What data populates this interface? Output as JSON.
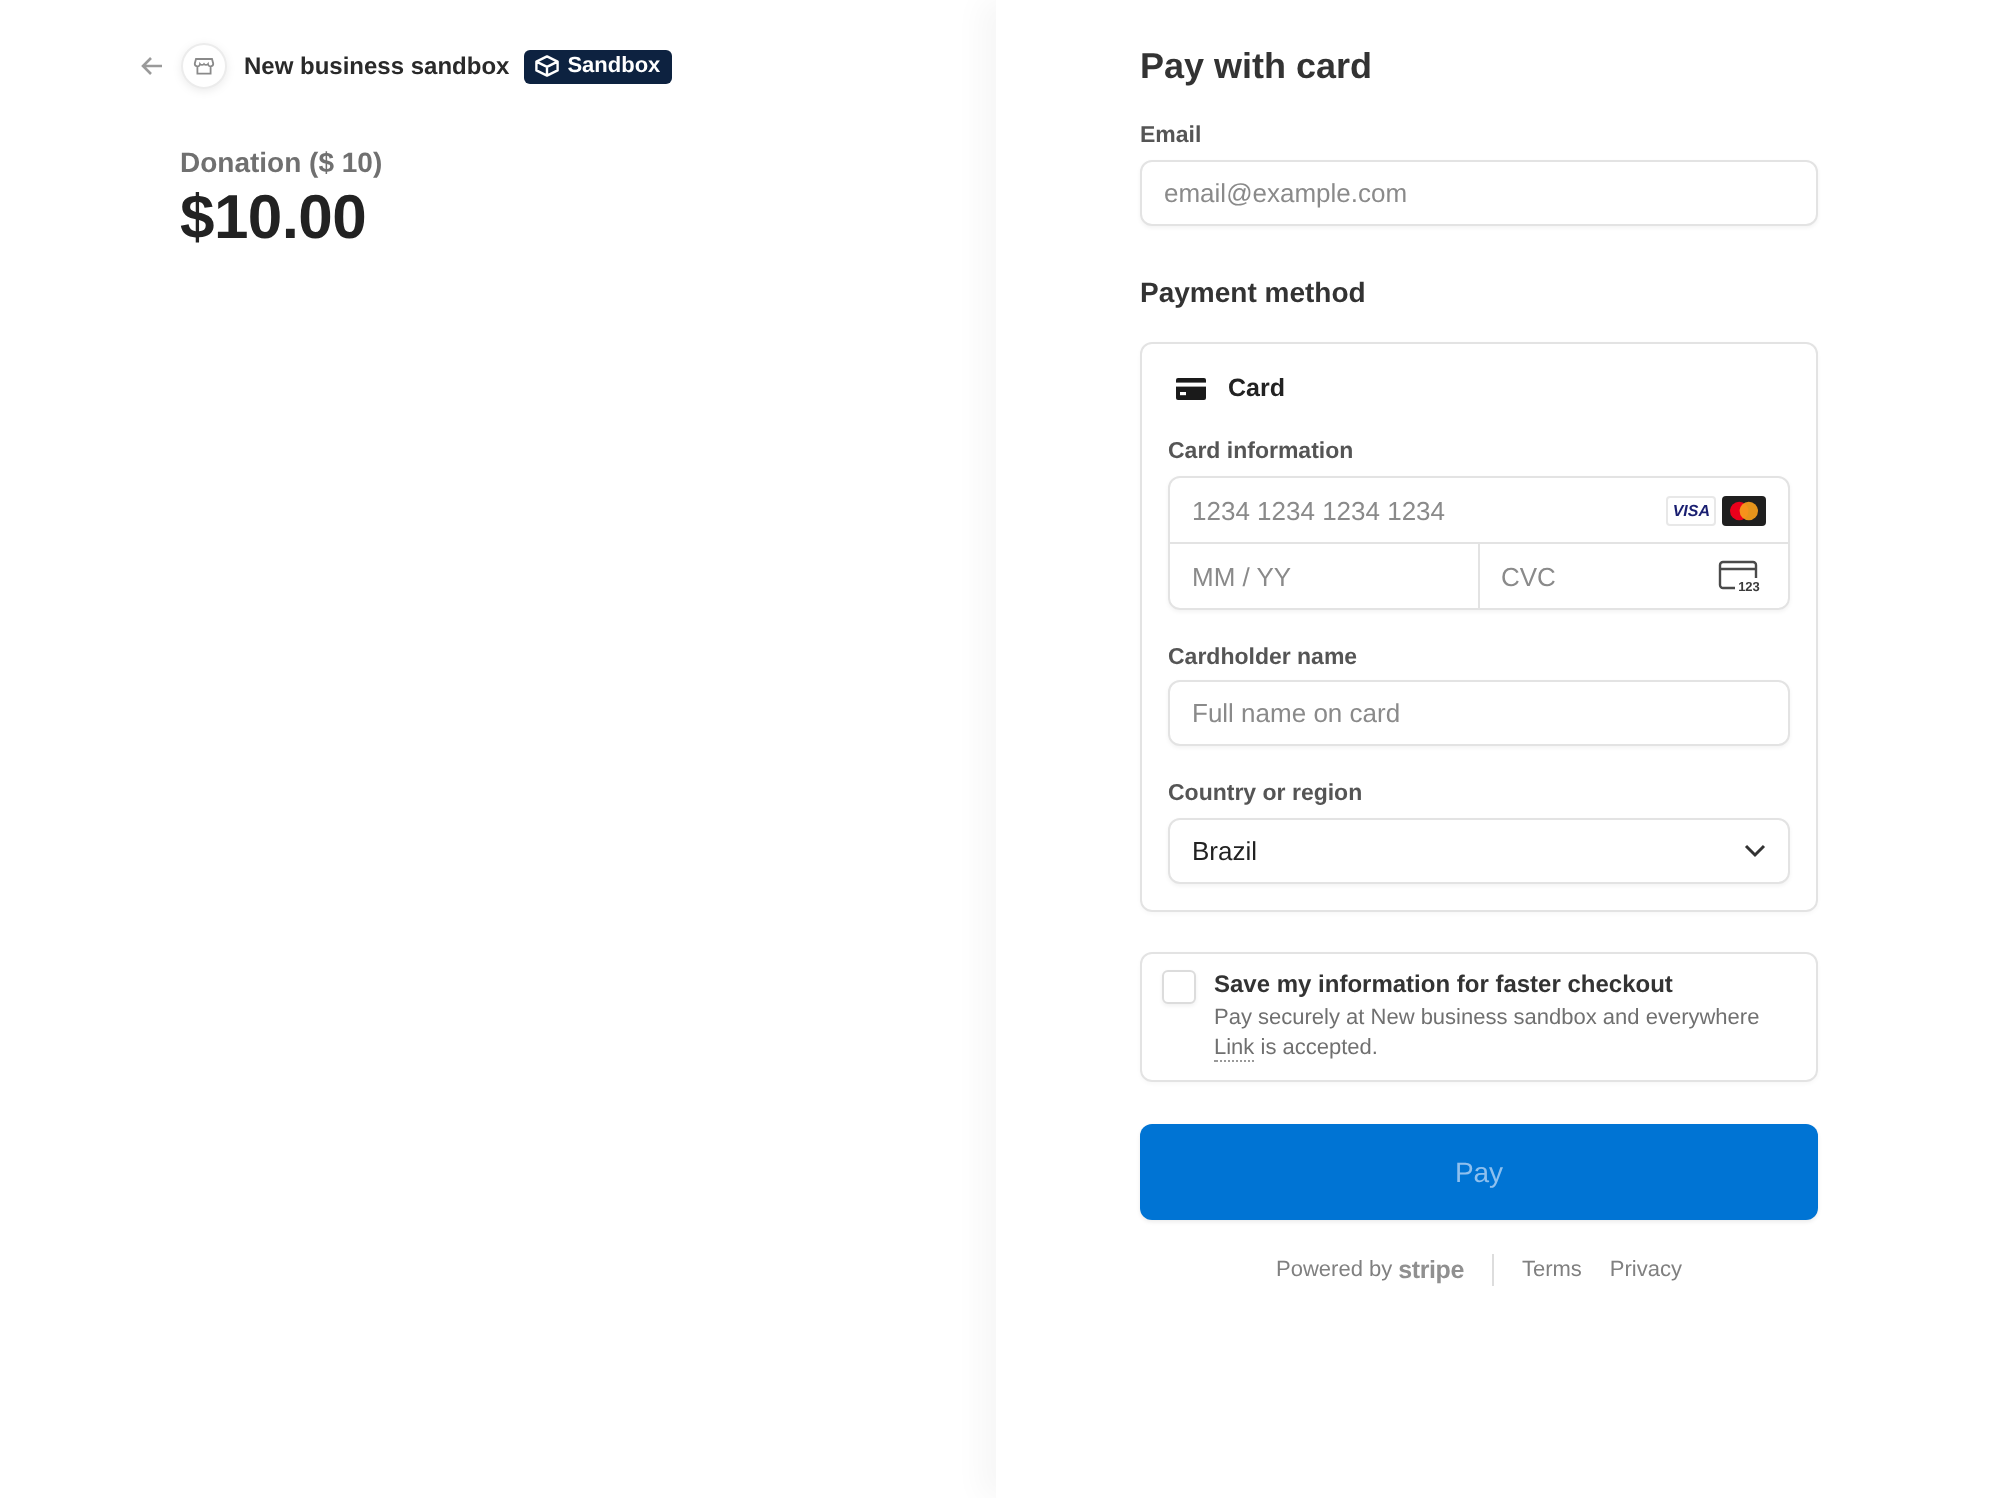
{
  "merchant": {
    "name": "New business sandbox",
    "badge": "Sandbox"
  },
  "summary": {
    "label": "Donation ($ 10)",
    "amount": "$10.00"
  },
  "checkout": {
    "title": "Pay with card",
    "email": {
      "label": "Email",
      "placeholder": "email@example.com"
    },
    "payment_method": {
      "heading": "Payment method",
      "option": "Card",
      "card_info": {
        "label": "Card information",
        "number_placeholder": "1234 1234 1234 1234",
        "visa_logo": "VISA",
        "expiry_placeholder": "MM / YY",
        "cvc_placeholder": "CVC",
        "cvc_icon_digits": "123"
      },
      "cardholder": {
        "label": "Cardholder name",
        "placeholder": "Full name on card"
      },
      "country": {
        "label": "Country or region",
        "value": "Brazil"
      }
    },
    "save_info": {
      "checked": false,
      "title": "Save my information for faster checkout",
      "text_before": "Pay securely at New business sandbox and everywhere",
      "link": "Link",
      "text_after": "is accepted."
    },
    "pay_button": {
      "label": "Pay",
      "disabled": true
    }
  },
  "footer": {
    "powered_by": "Powered by",
    "brand": "stripe",
    "links": [
      "Terms",
      "Privacy"
    ]
  }
}
